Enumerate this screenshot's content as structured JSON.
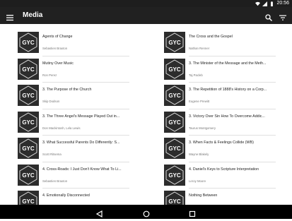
{
  "status_bar": {
    "time": "20:56",
    "icons": [
      "wifi-icon",
      "signal-icon",
      "battery-icon"
    ]
  },
  "app_bar": {
    "title": "Media",
    "menu_icon": "menu-icon",
    "search_icon": "search-icon",
    "filter_icon": "filter-icon"
  },
  "theme": {
    "appbar_bg": "#212121",
    "statusbar_bg": "#1e1e1e",
    "navbar_bg": "#000000"
  },
  "thumbnail": {
    "text": "GYC"
  },
  "left_items": [
    {
      "title": "Agents of Change",
      "subtitle": "Sebastien Braxton"
    },
    {
      "title": "Mutiny Over Music",
      "subtitle": "Ron Perez"
    },
    {
      "title": "3. The Purpose of the Church",
      "subtitle": "Skip Dodson"
    },
    {
      "title": "3. The Three Angel's Message Played Out in...",
      "subtitle": "Don Mackintosh, Lela Lewis"
    },
    {
      "title": "3. What Successful Parents Do Differently: S...",
      "subtitle": "Scott Ritsema"
    },
    {
      "title": "4. Cross-Roads: I Just Don't Know What To Li...",
      "subtitle": "Sebastien Braxton"
    },
    {
      "title": "4. Emotionally Disconnected",
      "subtitle": ""
    }
  ],
  "right_items": [
    {
      "title": "The Cross and the Gospel",
      "subtitle": "Nathan Renner"
    },
    {
      "title": "3. The Minister of the Message and the Meth...",
      "subtitle": "Taj Pacleb"
    },
    {
      "title": "3. The Repetition of 1888's History on a Corp...",
      "subtitle": "Eugene Prewitt"
    },
    {
      "title": "3. Victory Over Sin How To Overcome Addic...",
      "subtitle": "Taurus Montgomery"
    },
    {
      "title": "3. When Facts & Feelings Collide (WB)",
      "subtitle": "Wayne Blakely"
    },
    {
      "title": "4. Daniel's Keys to Scripture Interpretation",
      "subtitle": "Leroy Moore"
    },
    {
      "title": "Nothing Between",
      "subtitle": ""
    }
  ],
  "nav_bar": {
    "back_icon": "back-icon",
    "home_icon": "home-icon",
    "recents_icon": "recents-icon"
  }
}
